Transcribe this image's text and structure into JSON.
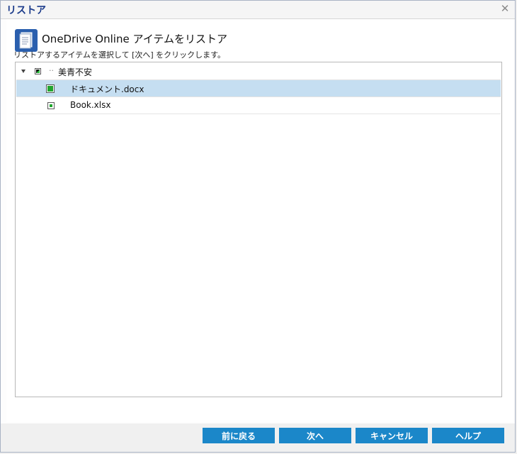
{
  "dialog": {
    "title": "リストア",
    "close_symbol": "✕"
  },
  "header": {
    "icon": "document-stack-icon",
    "title": "OneDrive Online アイテムをリストア",
    "instruction": "リストアするアイテムを選択して [次へ] をクリックします。"
  },
  "tree": {
    "root": {
      "label": "美青不安",
      "state": "partial",
      "expanded": true
    },
    "items": [
      {
        "label": "ドキュメント.docx",
        "state": "checked",
        "selected": true
      },
      {
        "label": "Book.xlsx",
        "state": "checked",
        "selected": false
      }
    ]
  },
  "buttons": {
    "back": "前に戻る",
    "next": "次へ",
    "cancel": "キャンセル",
    "help": "ヘルプ"
  },
  "colors": {
    "title_text": "#1a3a8a",
    "button_bg": "#1b87c9",
    "selected_row": "#c5def1",
    "checkbox_green": "#21a52f"
  }
}
